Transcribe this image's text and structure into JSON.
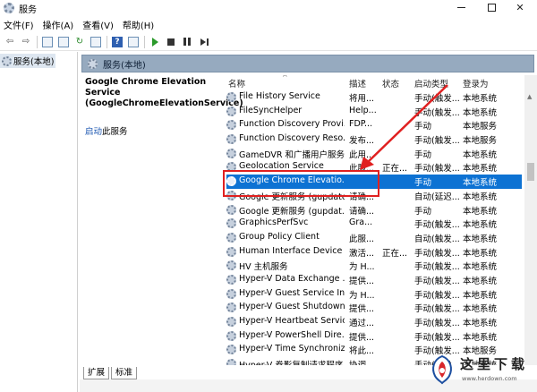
{
  "window": {
    "title": "服务"
  },
  "menu": [
    "文件(F)",
    "操作(A)",
    "查看(V)",
    "帮助(H)"
  ],
  "tree": {
    "root_label": "服务(本地)"
  },
  "header": {
    "title": "服务(本地)"
  },
  "detail": {
    "service_name": "Google Chrome Elevation Service (GoogleChromeElevationService)",
    "start_link": "启动",
    "start_suffix": "此服务"
  },
  "columns": {
    "name": "名称",
    "desc": "描述",
    "status": "状态",
    "start": "启动类型",
    "logon": "登录为"
  },
  "rows": [
    {
      "name": "File History Service",
      "desc": "将用...",
      "status": "",
      "start": "手动(触发...",
      "logon": "本地系统"
    },
    {
      "name": "FileSyncHelper",
      "desc": "Help...",
      "status": "",
      "start": "手动(触发...",
      "logon": "本地系统"
    },
    {
      "name": "Function Discovery Provi...",
      "desc": "FDP...",
      "status": "",
      "start": "手动",
      "logon": "本地服务"
    },
    {
      "name": "Function Discovery Reso...",
      "desc": "发布...",
      "status": "",
      "start": "手动(触发...",
      "logon": "本地服务"
    },
    {
      "name": "GameDVR 和广播用户服务...",
      "desc": "此用...",
      "status": "",
      "start": "手动",
      "logon": "本地系统"
    },
    {
      "name": "Geolocation Service",
      "desc": "此服...",
      "status": "正在...",
      "start": "手动(触发...",
      "logon": "本地系统"
    },
    {
      "name": "Google Chrome Elevatio...",
      "desc": "",
      "status": "",
      "start": "手动",
      "logon": "本地系统"
    },
    {
      "name": "Google 更新服务 (gupdate)",
      "desc": "请确...",
      "status": "",
      "start": "自动(延迟...",
      "logon": "本地系统"
    },
    {
      "name": "Google 更新服务 (gupdat...",
      "desc": "请确...",
      "status": "",
      "start": "手动",
      "logon": "本地系统"
    },
    {
      "name": "GraphicsPerfSvc",
      "desc": "Gra...",
      "status": "",
      "start": "手动(触发...",
      "logon": "本地系统"
    },
    {
      "name": "Group Policy Client",
      "desc": "此服...",
      "status": "",
      "start": "自动(触发...",
      "logon": "本地系统"
    },
    {
      "name": "Human Interface Device ...",
      "desc": "激活...",
      "status": "正在...",
      "start": "手动(触发...",
      "logon": "本地系统"
    },
    {
      "name": "HV 主机服务",
      "desc": "为 H...",
      "status": "",
      "start": "手动(触发...",
      "logon": "本地系统"
    },
    {
      "name": "Hyper-V Data Exchange ...",
      "desc": "提供...",
      "status": "",
      "start": "手动(触发...",
      "logon": "本地系统"
    },
    {
      "name": "Hyper-V Guest Service In...",
      "desc": "为 H...",
      "status": "",
      "start": "手动(触发...",
      "logon": "本地系统"
    },
    {
      "name": "Hyper-V Guest Shutdown...",
      "desc": "提供...",
      "status": "",
      "start": "手动(触发...",
      "logon": "本地系统"
    },
    {
      "name": "Hyper-V Heartbeat Service",
      "desc": "通过...",
      "status": "",
      "start": "手动(触发...",
      "logon": "本地系统"
    },
    {
      "name": "Hyper-V PowerShell Dire...",
      "desc": "提供...",
      "status": "",
      "start": "手动(触发...",
      "logon": "本地系统"
    },
    {
      "name": "Hyper-V Time Synchroniz...",
      "desc": "将此...",
      "status": "",
      "start": "手动(触发...",
      "logon": "本地服务"
    },
    {
      "name": "Hyper-V 卷影复制请求程序",
      "desc": "协调...",
      "status": "",
      "start": "手动(触发...",
      "logon": "本地系统"
    }
  ],
  "selected_row": 6,
  "tabs": [
    "扩展",
    "标准"
  ],
  "watermark": {
    "text": "这里下载",
    "url": "www.herdown.com"
  },
  "colors": {
    "selection": "#0d72d3",
    "header_bar": "#96aabf",
    "annotation": "#e02020"
  }
}
